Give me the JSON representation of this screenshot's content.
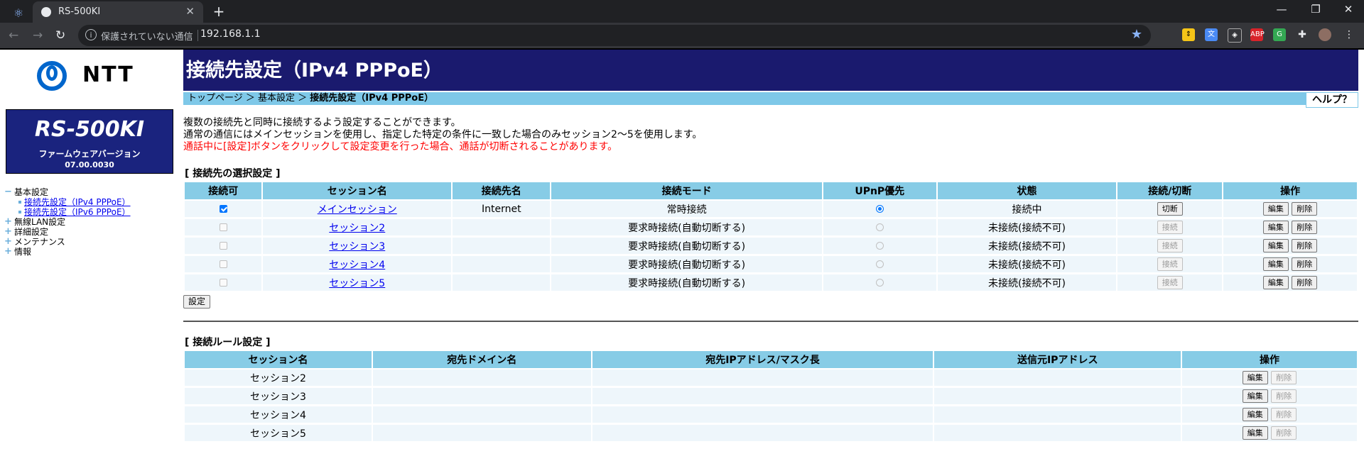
{
  "browser": {
    "tab_title": "RS-500KI",
    "security_label": "保護されていない通信",
    "url": "192.168.1.1"
  },
  "sidebar": {
    "brand": "NTT",
    "model": "RS-500KI",
    "firmware_label": "ファームウェアバージョン",
    "firmware_version": "07.00.0030",
    "menu": [
      {
        "label": "基本設定",
        "mark": "−",
        "children": [
          "接続先設定（IPv4 PPPoE）",
          "接続先設定（IPv6 PPPoE）"
        ]
      },
      {
        "label": "無線LAN設定",
        "mark": "+"
      },
      {
        "label": "詳細設定",
        "mark": "+"
      },
      {
        "label": "メンテナンス",
        "mark": "+"
      },
      {
        "label": "情報",
        "mark": "+"
      }
    ]
  },
  "main": {
    "title": "接続先設定（IPv4 PPPoE）",
    "breadcrumb": {
      "top": "トップページ",
      "sep": " ＞ ",
      "basic": "基本設定",
      "current": "接続先設定（IPv4 PPPoE）"
    },
    "help": "ヘルプ？",
    "desc1": "複数の接続先と同時に接続するよう設定することができます。",
    "desc2": "通常の通信にはメインセッションを使用し、指定した特定の条件に一致した場合のみセッション2〜5を使用します。",
    "warning": "通話中に[設定]ボタンをクリックして設定変更を行った場合、通話が切断されることがあります。",
    "section1": "[ 接続先の選択設定 ]",
    "table1_headers": [
      "接続可",
      "セッション名",
      "接続先名",
      "接続モード",
      "UPnP優先",
      "状態",
      "接続/切断",
      "操作"
    ],
    "sessions": [
      {
        "name": "メインセッション",
        "dest": "Internet",
        "mode": "常時接続",
        "status": "接続中",
        "conn": "切断",
        "enabled": true
      },
      {
        "name": "セッション2",
        "dest": "",
        "mode": "要求時接続(自動切断する)",
        "status": "未接続(接続不可)",
        "conn": "接続",
        "enabled": false
      },
      {
        "name": "セッション3",
        "dest": "",
        "mode": "要求時接続(自動切断する)",
        "status": "未接続(接続不可)",
        "conn": "接続",
        "enabled": false
      },
      {
        "name": "セッション4",
        "dest": "",
        "mode": "要求時接続(自動切断する)",
        "status": "未接続(接続不可)",
        "conn": "接続",
        "enabled": false
      },
      {
        "name": "セッション5",
        "dest": "",
        "mode": "要求時接続(自動切断する)",
        "status": "未接続(接続不可)",
        "conn": "接続",
        "enabled": false
      }
    ],
    "edit": "編集",
    "delete": "削除",
    "set_button": "設定",
    "section2": "[ 接続ルール設定 ]",
    "table2_headers": [
      "セッション名",
      "宛先ドメイン名",
      "宛先IPアドレス/マスク長",
      "送信元IPアドレス",
      "操作"
    ],
    "rules": [
      "セッション2",
      "セッション3",
      "セッション4",
      "セッション5"
    ]
  }
}
